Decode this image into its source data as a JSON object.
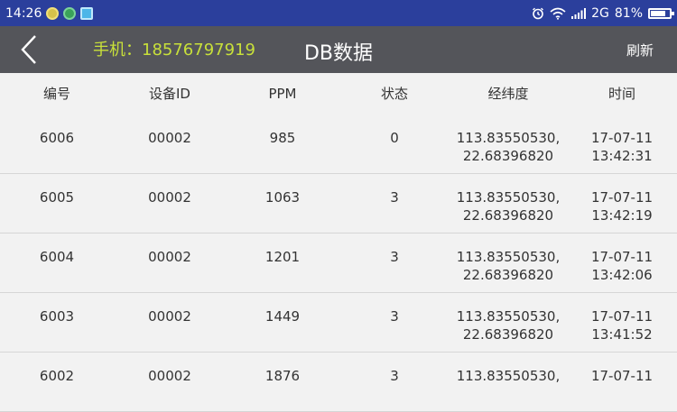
{
  "statusbar": {
    "time": "14:26",
    "network": "2G",
    "battery_pct": "81%",
    "battery_level": 0.81,
    "icons": [
      "notification-icon-yellow",
      "notification-icon-green",
      "notification-icon-blue",
      "alarm-icon",
      "wifi-icon",
      "signal-icon",
      "battery-icon"
    ]
  },
  "appbar": {
    "phone_label": "手机：18576797919",
    "title": "DB数据",
    "refresh_label": "刷新"
  },
  "table": {
    "headers": [
      "编号",
      "设备ID",
      "PPM",
      "状态",
      "经纬度",
      "时间"
    ],
    "rows": [
      {
        "id": "6006",
        "device": "00002",
        "ppm": "985",
        "status": "0",
        "lng": "113.83550530,",
        "lat": "22.68396820",
        "date": "17-07-11",
        "time": "13:42:31"
      },
      {
        "id": "6005",
        "device": "00002",
        "ppm": "1063",
        "status": "3",
        "lng": "113.83550530,",
        "lat": "22.68396820",
        "date": "17-07-11",
        "time": "13:42:19"
      },
      {
        "id": "6004",
        "device": "00002",
        "ppm": "1201",
        "status": "3",
        "lng": "113.83550530,",
        "lat": "22.68396820",
        "date": "17-07-11",
        "time": "13:42:06"
      },
      {
        "id": "6003",
        "device": "00002",
        "ppm": "1449",
        "status": "3",
        "lng": "113.83550530,",
        "lat": "22.68396820",
        "date": "17-07-11",
        "time": "13:41:52"
      },
      {
        "id": "6002",
        "device": "00002",
        "ppm": "1876",
        "status": "3",
        "lng": "113.83550530,",
        "lat": "",
        "date": "17-07-11",
        "time": ""
      }
    ]
  }
}
